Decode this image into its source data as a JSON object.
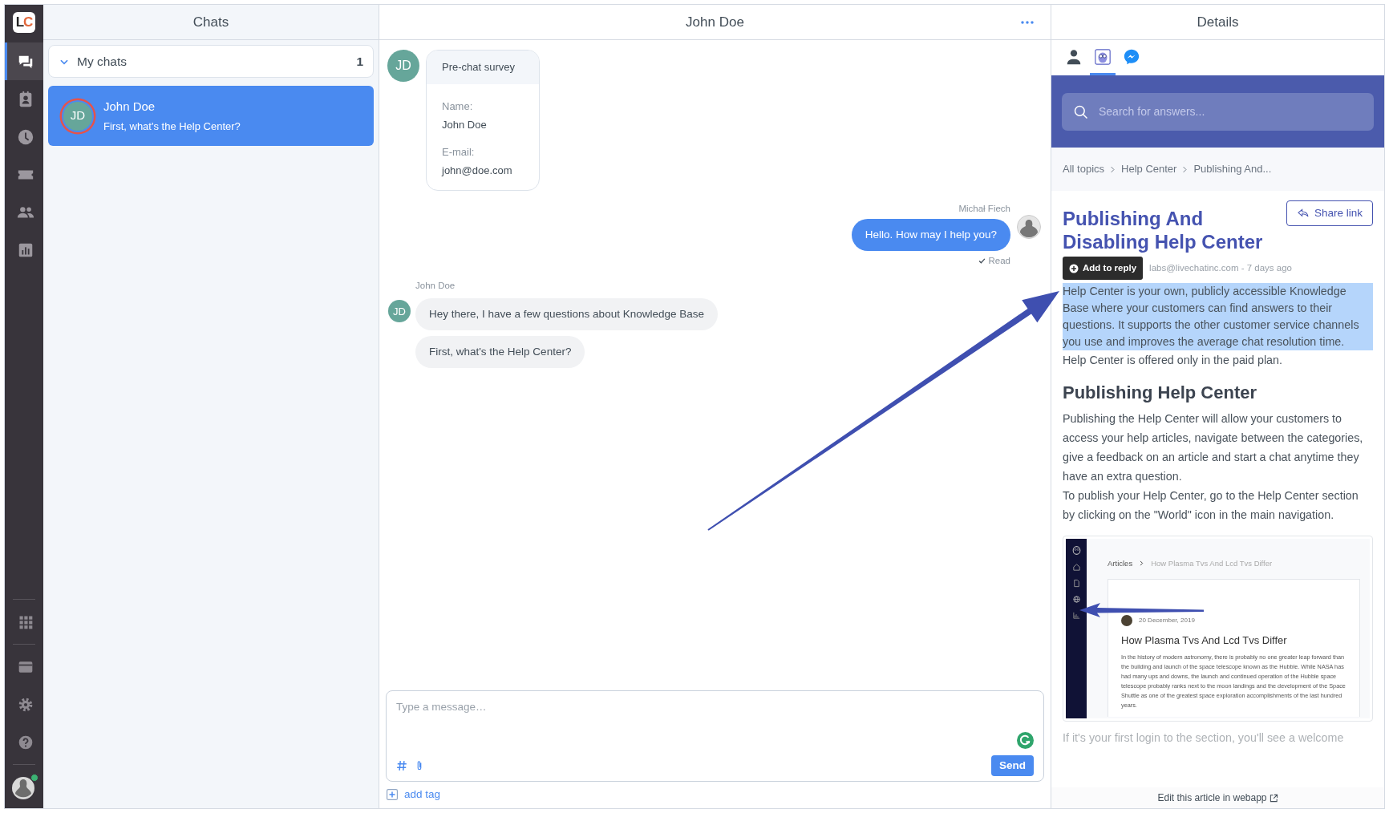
{
  "nav": {
    "logo": [
      "L",
      "C"
    ],
    "items": [
      {
        "kind": "chats",
        "selected": true
      },
      {
        "kind": "contacts",
        "selected": false
      },
      {
        "kind": "history",
        "selected": false
      },
      {
        "kind": "tickets",
        "selected": false
      },
      {
        "kind": "team",
        "selected": false
      },
      {
        "kind": "reports",
        "selected": false
      }
    ],
    "bottom_items": [
      {
        "kind": "apps"
      },
      {
        "kind": "billing"
      },
      {
        "kind": "settings"
      },
      {
        "kind": "help"
      }
    ],
    "user": {
      "online": true
    }
  },
  "chats_panel": {
    "title": "Chats",
    "group": {
      "label": "My chats",
      "count": "1",
      "expanded": true
    },
    "chats": [
      {
        "initials": "JD",
        "name": "John Doe",
        "preview": "First, what's the Help Center?",
        "selected": true
      }
    ]
  },
  "conversation": {
    "title": "John Doe",
    "messages": [
      {
        "kind": "survey",
        "initials": "JD",
        "title": "Pre-chat survey",
        "fields": [
          {
            "label": "Name:",
            "value": "John Doe"
          },
          {
            "label": "E-mail:",
            "value": "john@doe.com"
          }
        ]
      },
      {
        "kind": "agent",
        "author": "Michał Fiech",
        "texts": [
          "Hello. How may I help you?"
        ],
        "status": "Read"
      },
      {
        "kind": "customer",
        "author": "John Doe",
        "initials": "JD",
        "texts": [
          "Hey there, I have a few questions about Knowledge Base",
          "First, what's the Help Center?"
        ]
      }
    ],
    "composer": {
      "placeholder": "Type a message…",
      "send": "Send",
      "add_tag": "add tag"
    }
  },
  "details": {
    "title": "Details",
    "tabs": [
      {
        "kind": "person",
        "selected": false
      },
      {
        "kind": "bot",
        "selected": true
      },
      {
        "kind": "messenger",
        "selected": false
      }
    ],
    "search": {
      "placeholder": "Search for answers..."
    },
    "breadcrumb": [
      "All topics",
      "Help Center",
      "Publishing And..."
    ],
    "article": {
      "title": "Publishing And Disabling Help Center",
      "share": "Share link",
      "tooltip": "Add to reply",
      "meta": "labs@livechatinc.com - 7 days ago",
      "blocks": [
        {
          "kind": "p",
          "text": "Help Center is your own, publicly accessible Knowledge Base where your customers can find answers to their questions. It supports the other customer service channels you use and improves the average chat resolution time.",
          "highlighted": true
        },
        {
          "kind": "p",
          "text": "Help Center is offered only in the paid plan.",
          "highlighted": false
        },
        {
          "kind": "h2",
          "text": "Publishing Help Center"
        },
        {
          "kind": "p",
          "text": "Publishing the Help Center will allow your customers to access your help articles, navigate between the categories, give a feedback on an article and start a chat anytime they have an extra question.",
          "highlighted": false
        },
        {
          "kind": "p",
          "text": "To publish your Help Center, go to the Help Center section by clicking on the \"World\" icon in the main navigation.",
          "highlighted": false
        },
        {
          "kind": "screenshot",
          "breadcrumb": [
            "Articles",
            "How Plasma Tvs And Lcd Tvs Differ"
          ],
          "date": "20 December, 2019",
          "title": "How Plasma Tvs And Lcd Tvs Differ",
          "text": "In the history of modern astronomy, there is probably no one greater leap forward than the building and launch of the space telescope known as the Hubble. While NASA has had many ups and downs, the launch and continued operation of the Hubble space telescope probably ranks next to the moon landings and the development of the Space Shuttle as one of the greatest space exploration accomplishments of the last hundred years."
        },
        {
          "kind": "p",
          "text": "If it's your first login to the section, you'll see a welcome",
          "highlighted": false,
          "faded": true
        }
      ]
    },
    "footer": "Edit this article in webapp"
  }
}
